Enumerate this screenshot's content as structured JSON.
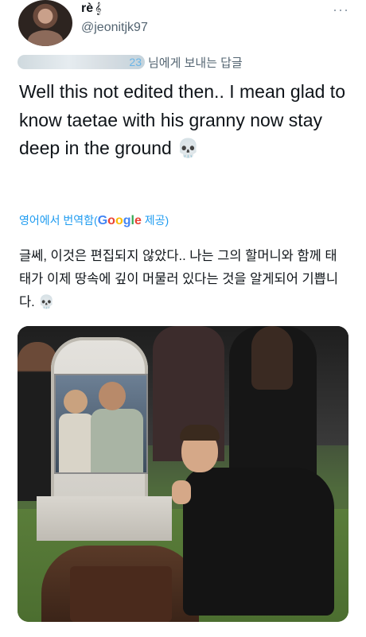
{
  "header": {
    "display_name": "rè",
    "name_symbol": "𝄞",
    "handle": "@jeonitjk97",
    "more": "···"
  },
  "reply": {
    "redacted_suffix": "23",
    "text": "님에게 보내는 답글"
  },
  "tweet": {
    "text": "Well this not edited then.. I mean glad to know taetae with his granny now stay deep in the ground 💀",
    "translate_prefix": "영어에서 번역함(",
    "translate_brand": [
      "G",
      "o",
      "o",
      "g",
      "l",
      "e"
    ],
    "translate_suffix": " 제공)",
    "translated_text": "글쎄, 이것은 편집되지 않았다.. 나는 그의 할머니와 함께 태태가 이제 땅속에 깊이 머물러 있다는 것을 알게되어 기쁩니다. 💀"
  },
  "colors": {
    "link": "#1d9bf0",
    "secondary_text": "#536471",
    "primary_text": "#0f1419"
  }
}
